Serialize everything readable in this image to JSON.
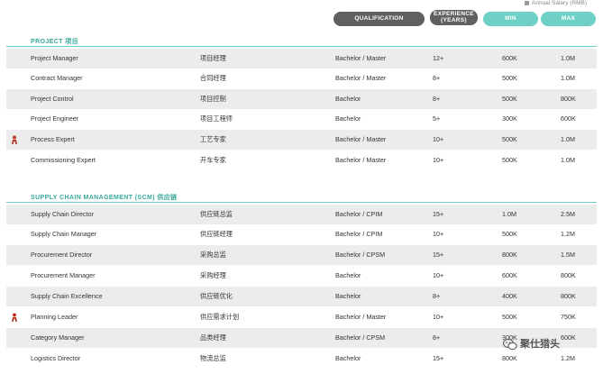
{
  "legend": {
    "label": "Annual Salary (RMB)"
  },
  "header": {
    "qualification": "QUALIFICATION",
    "experience_line1": "EXPERIENCE",
    "experience_line2": "(YEARS)",
    "min": "MIN",
    "max": "MAX"
  },
  "sections": [
    {
      "title": "PROJECT 项目",
      "rows": [
        {
          "en": "Project Manager",
          "cn": "项目经理",
          "qualification": "Bachelor / Master",
          "experience": "12+",
          "min": "600K",
          "max": "1.0M",
          "flag": false
        },
        {
          "en": "Contract Manager",
          "cn": "合同经理",
          "qualification": "Bachelor / Master",
          "experience": "8+",
          "min": "500K",
          "max": "1.0M",
          "flag": false
        },
        {
          "en": "Project Control",
          "cn": "项目控制",
          "qualification": "Bachelor",
          "experience": "8+",
          "min": "500K",
          "max": "800K",
          "flag": false
        },
        {
          "en": "Project Engineer",
          "cn": "项目工程师",
          "qualification": "Bachelor",
          "experience": "5+",
          "min": "300K",
          "max": "600K",
          "flag": false
        },
        {
          "en": "Process Expert",
          "cn": "工艺专家",
          "qualification": "Bachelor / Master",
          "experience": "10+",
          "min": "500K",
          "max": "1.0M",
          "flag": true
        },
        {
          "en": "Commissioning Expert",
          "cn": "开车专家",
          "qualification": "Bachelor / Master",
          "experience": "10+",
          "min": "500K",
          "max": "1.0M",
          "flag": false
        }
      ]
    },
    {
      "title": "SUPPLY CHAIN MANAGEMENT (SCM) 供应链",
      "rows": [
        {
          "en": "Supply Chain Director",
          "cn": "供应链总监",
          "qualification": "Bachelor / CPIM",
          "experience": "15+",
          "min": "1.0M",
          "max": "2.5M",
          "flag": false
        },
        {
          "en": "Supply Chain Manager",
          "cn": "供应链经理",
          "qualification": "Bachelor / CPIM",
          "experience": "10+",
          "min": "500K",
          "max": "1.2M",
          "flag": false
        },
        {
          "en": "Procurement Director",
          "cn": "采购总监",
          "qualification": "Bachelor / CPSM",
          "experience": "15+",
          "min": "800K",
          "max": "1.5M",
          "flag": false
        },
        {
          "en": "Procurement Manager",
          "cn": "采购经理",
          "qualification": "Bachelor",
          "experience": "10+",
          "min": "600K",
          "max": "800K",
          "flag": false
        },
        {
          "en": "Supply Chain Excellence",
          "cn": "供应链优化",
          "qualification": "Bachelor",
          "experience": "8+",
          "min": "400K",
          "max": "800K",
          "flag": false
        },
        {
          "en": "Planning Leader",
          "cn": "供应需求计划",
          "qualification": "Bachelor / Master",
          "experience": "10+",
          "min": "500K",
          "max": "750K",
          "flag": true
        },
        {
          "en": "Category Manager",
          "cn": "品类经理",
          "qualification": "Bachelor / CPSM",
          "experience": "8+",
          "min": "300K",
          "max": "600K",
          "flag": false
        },
        {
          "en": "Logistics Director",
          "cn": "物流总监",
          "qualification": "Bachelor",
          "experience": "15+",
          "min": "800K",
          "max": "1.2M",
          "flag": false
        }
      ]
    }
  ],
  "watermark": {
    "text": "聚仕猎头"
  },
  "colors": {
    "accent": "#6fd1c6",
    "accent_text": "#3aa89c",
    "dark_pill": "#5f6062",
    "row_shade": "#ececec",
    "flag": "#c0392b"
  },
  "icons": {
    "flag": "person-flag-icon",
    "watermark": "wechat-icon"
  }
}
